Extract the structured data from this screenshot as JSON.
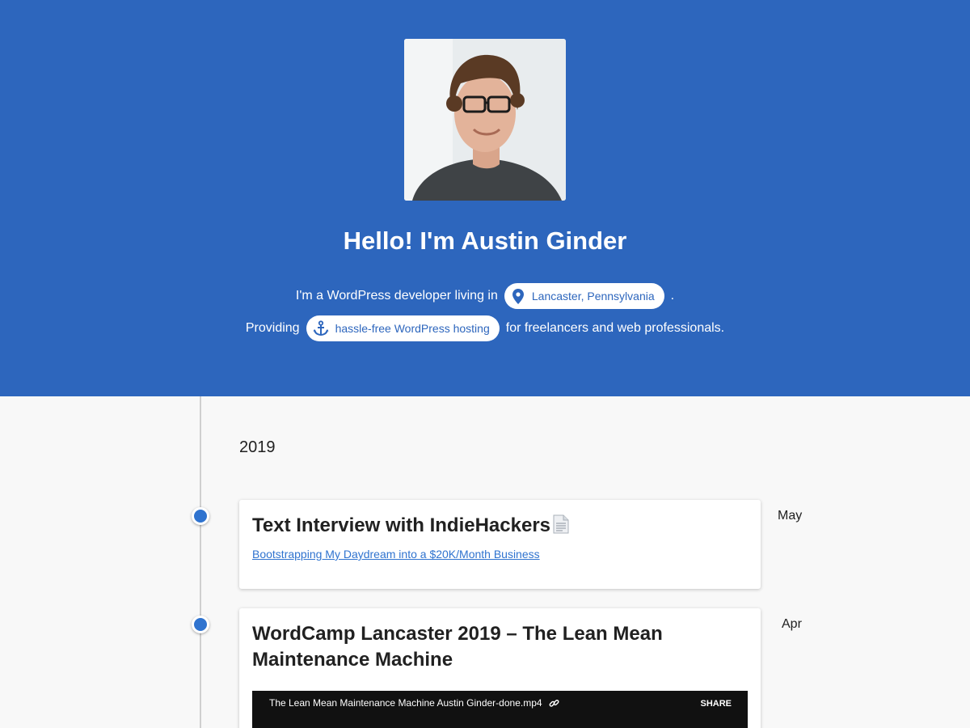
{
  "hero": {
    "title": "Hello! I'm Austin Ginder",
    "line1_prefix": "I'm a WordPress developer living in",
    "location_chip": "Lancaster, Pennsylvania",
    "line1_suffix": ".",
    "line2_prefix": "Providing",
    "hosting_chip": "hassle-free WordPress hosting",
    "line2_suffix": "for freelancers and web professionals.",
    "location_icon": "map-pin-icon",
    "hosting_icon": "anchor-icon"
  },
  "timeline": {
    "year": "2019",
    "entries": [
      {
        "month": "May",
        "title": "Text Interview with IndieHackers",
        "emoji": "📄",
        "link_text": "Bootstrapping My Daydream into a $20K/Month Business"
      },
      {
        "month": "Apr",
        "title": "WordCamp Lancaster 2019 – The Lean Mean Maintenance Machine",
        "video_title": "The Lean Mean Maintenance Machine Austin Ginder-done.mp4",
        "video_share": "SHARE"
      }
    ]
  },
  "colors": {
    "hero_bg": "#2d66bd",
    "accent": "#2f73cf",
    "page_bg": "#f8f8f8"
  }
}
